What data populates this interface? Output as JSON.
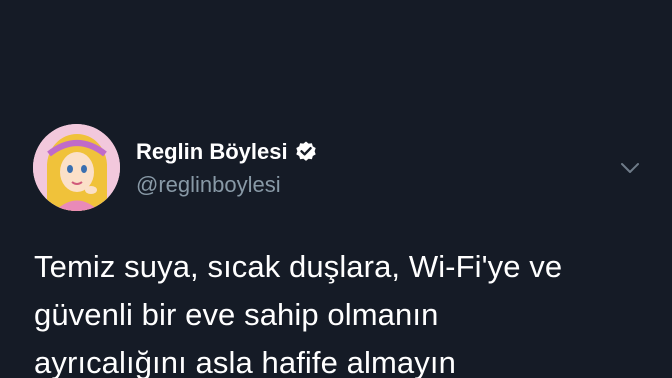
{
  "tweet": {
    "display_name": "Reglin Böylesi",
    "handle": "@reglinboylesi",
    "verified": true,
    "icons": {
      "verified": "verified-badge-icon",
      "more": "chevron-down-icon"
    },
    "text": "Temiz suya, sıcak duşlara, Wi-Fi'ye ve\ngüvenli bir eve sahip olmanın\nayrıcalığını asla hafife almayın"
  },
  "colors": {
    "background": "#151b26",
    "primary_text": "#ffffff",
    "secondary_text": "#8899a6"
  }
}
